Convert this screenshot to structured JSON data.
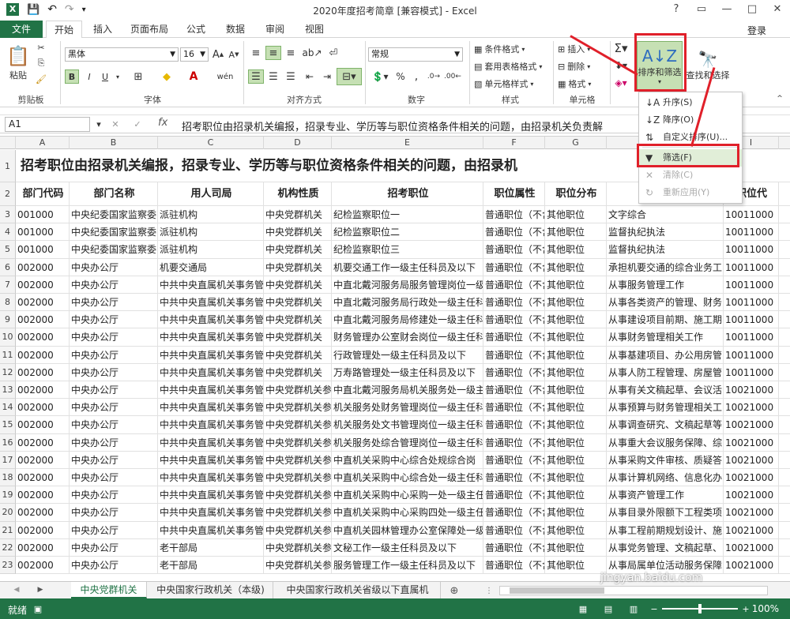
{
  "window": {
    "title": "2020年度招考简章 [兼容模式] - Excel",
    "login": "登录",
    "help": "?",
    "restore": "▭",
    "minimize": "—",
    "maximize": "□",
    "close": "✕"
  },
  "tabs": [
    "文件",
    "开始",
    "插入",
    "页面布局",
    "公式",
    "数据",
    "审阅",
    "视图"
  ],
  "ribbon": {
    "clipboard": {
      "label": "剪贴板",
      "paste": "粘贴"
    },
    "font": {
      "label": "字体",
      "name": "黑体",
      "size": "16",
      "bold": "B",
      "italic": "I",
      "underline": "U",
      "wen": "wén"
    },
    "align": {
      "label": "对齐方式"
    },
    "number": {
      "label": "数字",
      "format": "常规"
    },
    "styles": {
      "label": "样式",
      "cond": "条件格式",
      "table": "套用表格格式",
      "cell": "单元格样式"
    },
    "cells": {
      "label": "单元格",
      "insert": "插入",
      "delete": "删除",
      "format": "格式"
    },
    "editing": {
      "sort": "排序和筛选",
      "find": "查找和选择"
    }
  },
  "formula_bar": {
    "namebox": "A1",
    "fx": "fx",
    "text": "招考职位由招录机关编报，招录专业、学历等与职位资格条件相关的问题，由招录机关负责解"
  },
  "dropdown": {
    "items": [
      {
        "icon": "↓A",
        "label": "升序(S)",
        "disabled": false
      },
      {
        "icon": "↓Z",
        "label": "降序(O)",
        "disabled": false
      },
      {
        "icon": "⇅",
        "label": "自定义排序(U)...",
        "disabled": false
      },
      {
        "icon": "▼",
        "label": "筛选(F)",
        "disabled": false
      },
      {
        "icon": "✕",
        "label": "清除(C)",
        "disabled": true
      },
      {
        "icon": "↻",
        "label": "重新应用(Y)",
        "disabled": true
      }
    ]
  },
  "sheet": {
    "columns": [
      "A",
      "B",
      "C",
      "D",
      "E",
      "F",
      "G",
      "H",
      "I"
    ],
    "title_row": "招考职位由招录机关编报，招录专业、学历等与职位资格条件相关的问题，由招录机",
    "headers": [
      "部门代码",
      "部门名称",
      "用人司局",
      "机构性质",
      "招考职位",
      "职位属性",
      "职位分布",
      "",
      "职位代"
    ],
    "rows": [
      [
        "001000",
        "中央纪委国家监察委",
        "派驻机构",
        "中央党群机关",
        "纪检监察职位一",
        "普通职位（不含",
        "其他职位",
        "文字综合",
        "10011000"
      ],
      [
        "001000",
        "中央纪委国家监察委",
        "派驻机构",
        "中央党群机关",
        "纪检监察职位二",
        "普通职位（不含",
        "其他职位",
        "监督执纪执法",
        "10011000"
      ],
      [
        "001000",
        "中央纪委国家监察委",
        "派驻机构",
        "中央党群机关",
        "纪检监察职位三",
        "普通职位（不含",
        "其他职位",
        "监督执纪执法",
        "10011000"
      ],
      [
        "002000",
        "中央办公厅",
        "机要交通局",
        "中央党群机关",
        "机要交通工作一级主任科员及以下",
        "普通职位（不含",
        "其他职位",
        "承担机要交通的综合业务工",
        "10011000"
      ],
      [
        "002000",
        "中央办公厅",
        "中共中央直属机关事务管",
        "中央党群机关",
        "中直北戴河服务局服务管理岗位一级",
        "普通职位（不含",
        "其他职位",
        "从事服务管理工作",
        "10011000"
      ],
      [
        "002000",
        "中央办公厅",
        "中共中央直属机关事务管",
        "中央党群机关",
        "中直北戴河服务局行政处一级主任科",
        "普通职位（不含",
        "其他职位",
        "从事各类资产的管理、财务",
        "10011000"
      ],
      [
        "002000",
        "中央办公厅",
        "中共中央直属机关事务管",
        "中央党群机关",
        "中直北戴河服务局修建处一级主任科",
        "普通职位（不含",
        "其他职位",
        "从事建设项目前期、施工期",
        "10011000"
      ],
      [
        "002000",
        "中央办公厅",
        "中共中央直属机关事务管",
        "中央党群机关",
        "财务管理办公室财会岗位一级主任科",
        "普通职位（不含",
        "其他职位",
        "从事财务管理相关工作",
        "10011000"
      ],
      [
        "002000",
        "中央办公厅",
        "中共中央直属机关事务管",
        "中央党群机关",
        "行政管理处一级主任科员及以下",
        "普通职位（不含",
        "其他职位",
        "从事基建项目、办公用房管",
        "10011000"
      ],
      [
        "002000",
        "中央办公厅",
        "中共中央直属机关事务管",
        "中央党群机关",
        "万寿路管理处一级主任科员及以下",
        "普通职位（不含",
        "其他职位",
        "从事人防工程管理、房屋管",
        "10011000"
      ],
      [
        "002000",
        "中央办公厅",
        "中共中央直属机关事务管",
        "中央党群机关参",
        "中直北戴河服务局机关服务处一级主",
        "普通职位（不含",
        "其他职位",
        "从事有关文稿起草、会议活",
        "10021000"
      ],
      [
        "002000",
        "中央办公厅",
        "中共中央直属机关事务管",
        "中央党群机关参",
        "机关服务处财务管理岗位一级主任科",
        "普通职位（不含",
        "其他职位",
        "从事预算与财务管理相关工",
        "10021000"
      ],
      [
        "002000",
        "中央办公厅",
        "中共中央直属机关事务管",
        "中央党群机关参",
        "机关服务处文书管理岗位一级主任科",
        "普通职位（不含",
        "其他职位",
        "从事调查研究、文稿起草等",
        "10021000"
      ],
      [
        "002000",
        "中央办公厅",
        "中共中央直属机关事务管",
        "中央党群机关参",
        "机关服务处综合管理岗位一级主任科",
        "普通职位（不含",
        "其他职位",
        "从事重大会议服务保障、综",
        "10021000"
      ],
      [
        "002000",
        "中央办公厅",
        "中共中央直属机关事务管",
        "中央党群机关参",
        "中直机关采购中心综合处规综合岗",
        "普通职位（不含",
        "其他职位",
        "从事采购文件审核、质疑答",
        "10021000"
      ],
      [
        "002000",
        "中央办公厅",
        "中共中央直属机关事务管",
        "中央党群机关参",
        "中直机关采购中心综合处一级主任科",
        "普通职位（不含",
        "其他职位",
        "从事计算机网络、信息化办",
        "10021000"
      ],
      [
        "002000",
        "中央办公厅",
        "中共中央直属机关事务管",
        "中央党群机关参",
        "中直机关采购中心采购一处一级主任",
        "普通职位（不含",
        "其他职位",
        "从事资产管理工作",
        "10021000"
      ],
      [
        "002000",
        "中央办公厅",
        "中共中央直属机关事务管",
        "中央党群机关参",
        "中直机关采购中心采购四处一级主任",
        "普通职位（不含",
        "其他职位",
        "从事目录外限额下工程类项",
        "10021000"
      ],
      [
        "002000",
        "中央办公厅",
        "中共中央直属机关事务管",
        "中央党群机关参",
        "中直机关园林管理办公室保障处一级",
        "普通职位（不含",
        "其他职位",
        "从事工程前期规划设计、施",
        "10021000"
      ],
      [
        "002000",
        "中央办公厅",
        "老干部局",
        "中央党群机关参",
        "文秘工作一级主任科员及以下",
        "普通职位（不含",
        "其他职位",
        "从事党务管理、文稿起草、",
        "10021000"
      ],
      [
        "002000",
        "中央办公厅",
        "老干部局",
        "中央党群机关参",
        "服务管理工作一级主任科员及以下",
        "普通职位（不含",
        "其他职位",
        "从事局属单位活动服务保障",
        "10021000"
      ]
    ]
  },
  "sheet_tabs": [
    "中央党群机关",
    "中央国家行政机关（本级)",
    "中央国家行政机关省级以下直属机"
  ],
  "status": {
    "ready": "就绪",
    "zoom": "100%"
  },
  "watermark": "jingyan.baidu.com",
  "colors": {
    "accent": "#217346",
    "highlight": "#e0202a"
  }
}
